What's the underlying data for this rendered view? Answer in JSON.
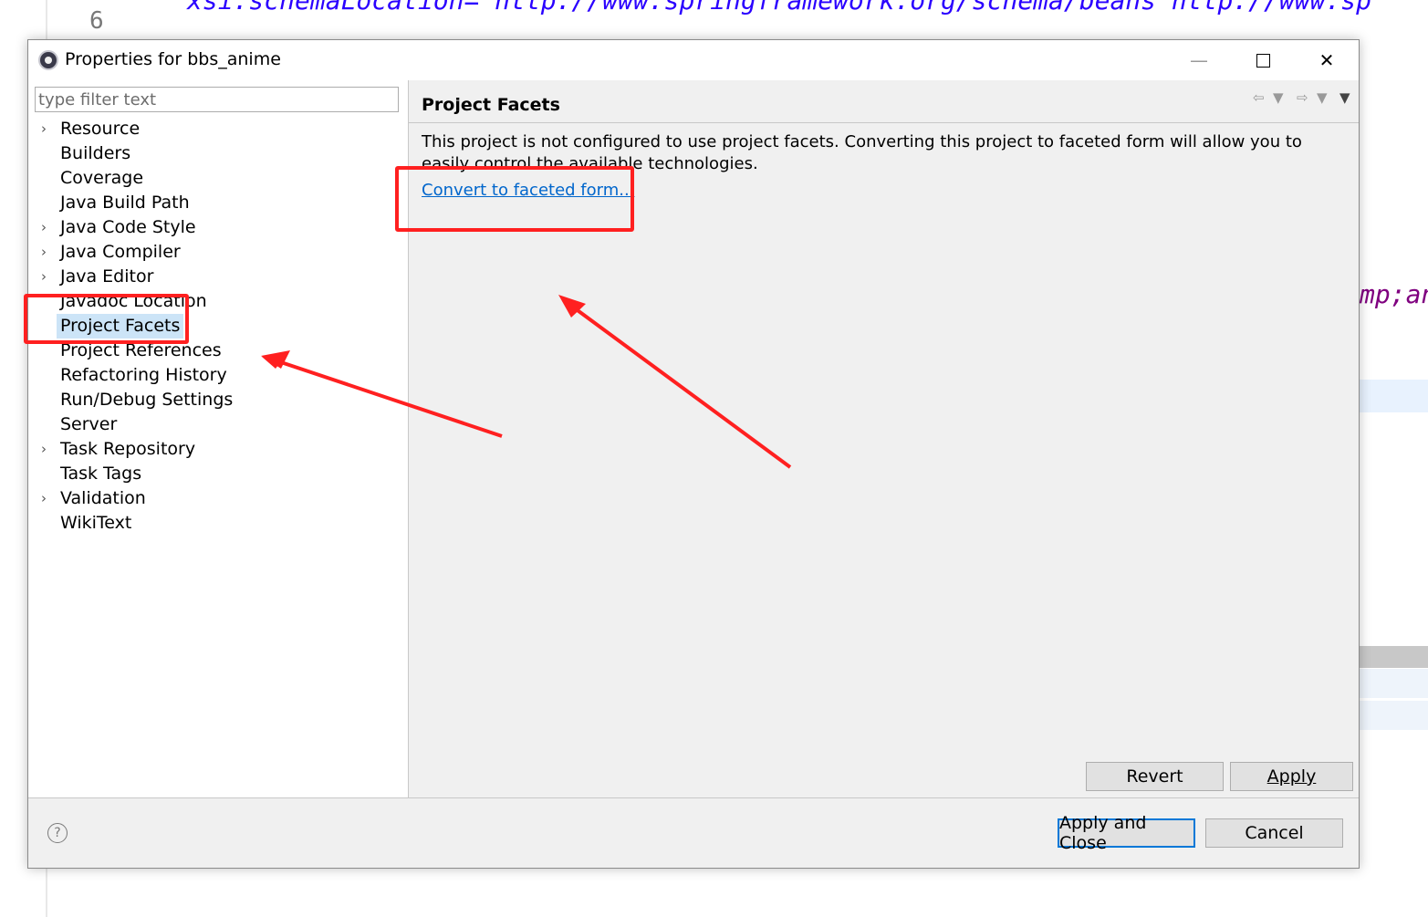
{
  "background_editor": {
    "line_number": "6",
    "code_top": "xsi:schemaLocation=\"http://www.springframework.org/schema/beans http://www.sp",
    "code_mid": "mp;an"
  },
  "dialog": {
    "title": "Properties for bbs_anime",
    "window_buttons": {
      "minimize": "—",
      "close": "✕"
    }
  },
  "filter": {
    "placeholder": "type filter text",
    "value": ""
  },
  "tree": [
    {
      "label": "Resource",
      "expandable": true
    },
    {
      "label": "Builders",
      "expandable": false
    },
    {
      "label": "Coverage",
      "expandable": false
    },
    {
      "label": "Java Build Path",
      "expandable": false
    },
    {
      "label": "Java Code Style",
      "expandable": true
    },
    {
      "label": "Java Compiler",
      "expandable": true
    },
    {
      "label": "Java Editor",
      "expandable": true
    },
    {
      "label": "Javadoc Location",
      "expandable": false
    },
    {
      "label": "Project Facets",
      "expandable": false,
      "selected": true
    },
    {
      "label": "Project References",
      "expandable": false
    },
    {
      "label": "Refactoring History",
      "expandable": false
    },
    {
      "label": "Run/Debug Settings",
      "expandable": false
    },
    {
      "label": "Server",
      "expandable": false
    },
    {
      "label": "Task Repository",
      "expandable": true
    },
    {
      "label": "Task Tags",
      "expandable": false
    },
    {
      "label": "Validation",
      "expandable": true
    },
    {
      "label": "WikiText",
      "expandable": false
    }
  ],
  "page": {
    "title": "Project Facets",
    "description": "This project is not configured to use project facets. Converting this project to faceted form will allow you to easily control the available technologies.",
    "convert_link": "Convert to faceted form...",
    "revert_label": "Revert",
    "apply_label": "Apply"
  },
  "footer": {
    "help_icon": "?",
    "apply_close_label": "Apply and Close",
    "cancel_label": "Cancel"
  },
  "annotations": {
    "color": "#ff2020"
  }
}
